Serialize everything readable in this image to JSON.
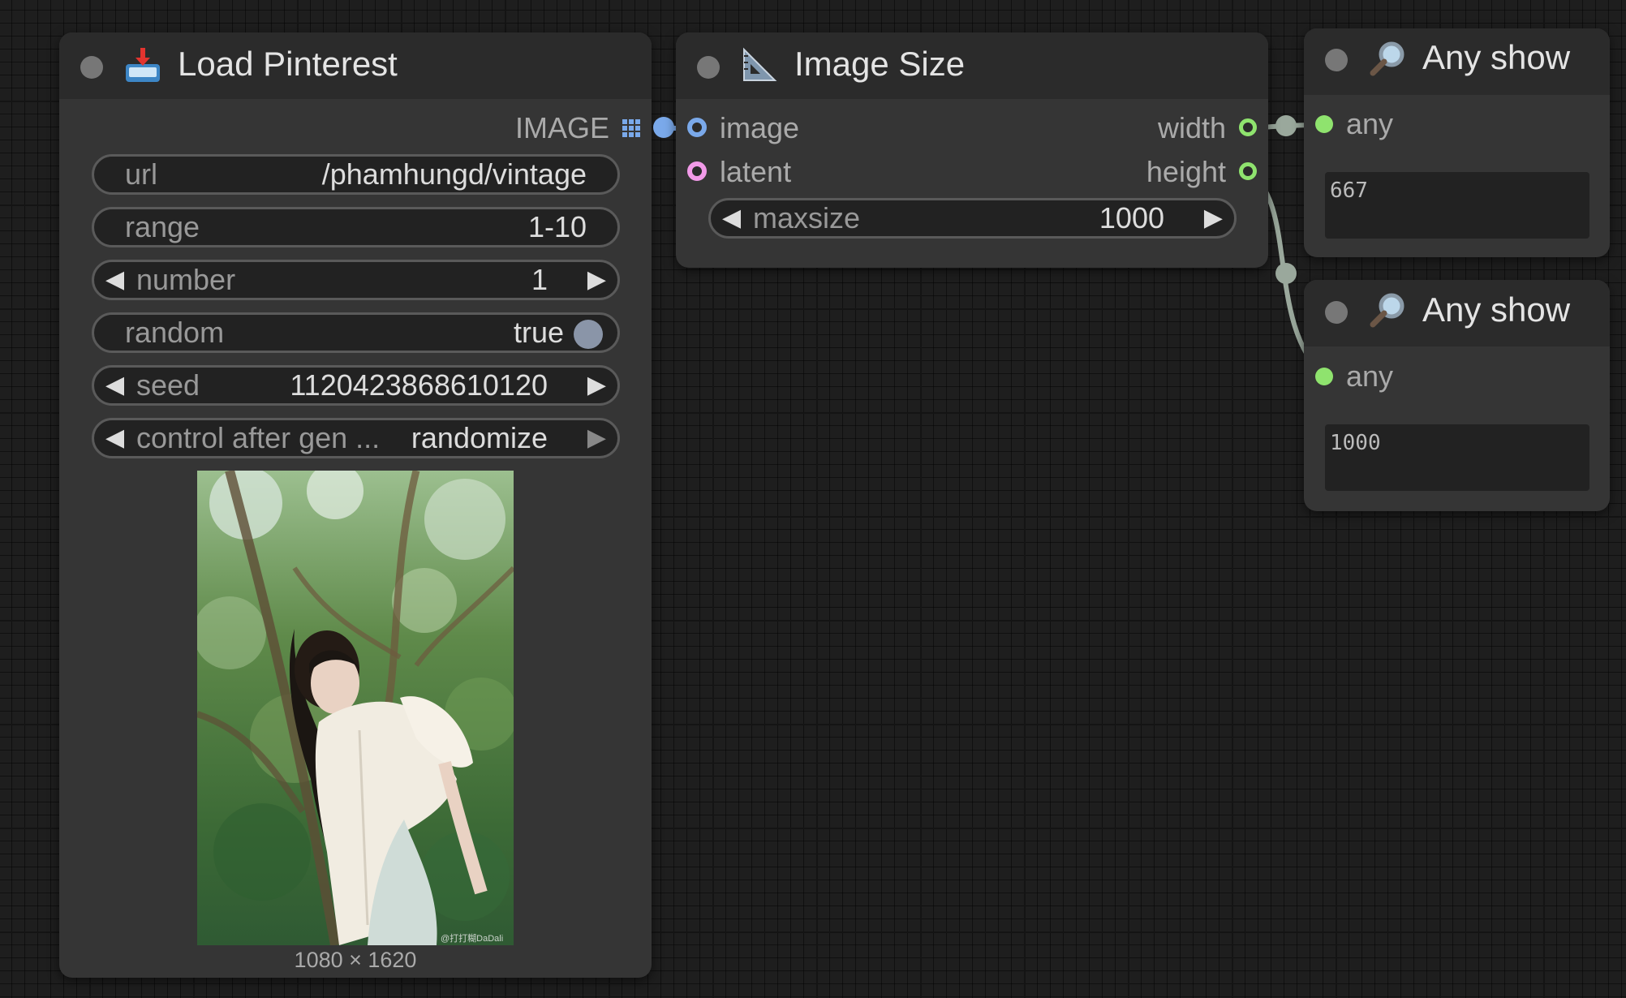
{
  "colors": {
    "image_slot": "#7aa9ea",
    "latent_slot": "#f29ae8",
    "int_slot": "#8fe36e",
    "wire": "#9aa89c"
  },
  "load_pinterest": {
    "title": "Load Pinterest",
    "title_icon": "inbox-tray-icon",
    "output_label": "IMAGE",
    "widgets": {
      "url": {
        "label": "url",
        "value": "/phamhungd/vintage"
      },
      "range": {
        "label": "range",
        "value": "1-10"
      },
      "number": {
        "label": "number",
        "value": "1"
      },
      "random": {
        "label": "random",
        "value": "true"
      },
      "seed": {
        "label": "seed",
        "value": "1120423868610120"
      },
      "control": {
        "label": "control after gen ...",
        "value": "randomize"
      }
    },
    "preview": {
      "watermark": "@打打糊DaDali",
      "caption": "1080 × 1620"
    }
  },
  "image_size": {
    "title": "Image Size",
    "title_icon": "triangle-ruler-icon",
    "inputs": {
      "image": "image",
      "latent": "latent"
    },
    "outputs": {
      "width": "width",
      "height": "height"
    },
    "maxsize": {
      "label": "maxsize",
      "value": "1000"
    }
  },
  "any_show_1": {
    "title": "Any show",
    "title_icon": "magnifier-icon",
    "input": "any",
    "text": "667"
  },
  "any_show_2": {
    "title": "Any show",
    "title_icon": "magnifier-icon",
    "input": "any",
    "text": "1000"
  }
}
